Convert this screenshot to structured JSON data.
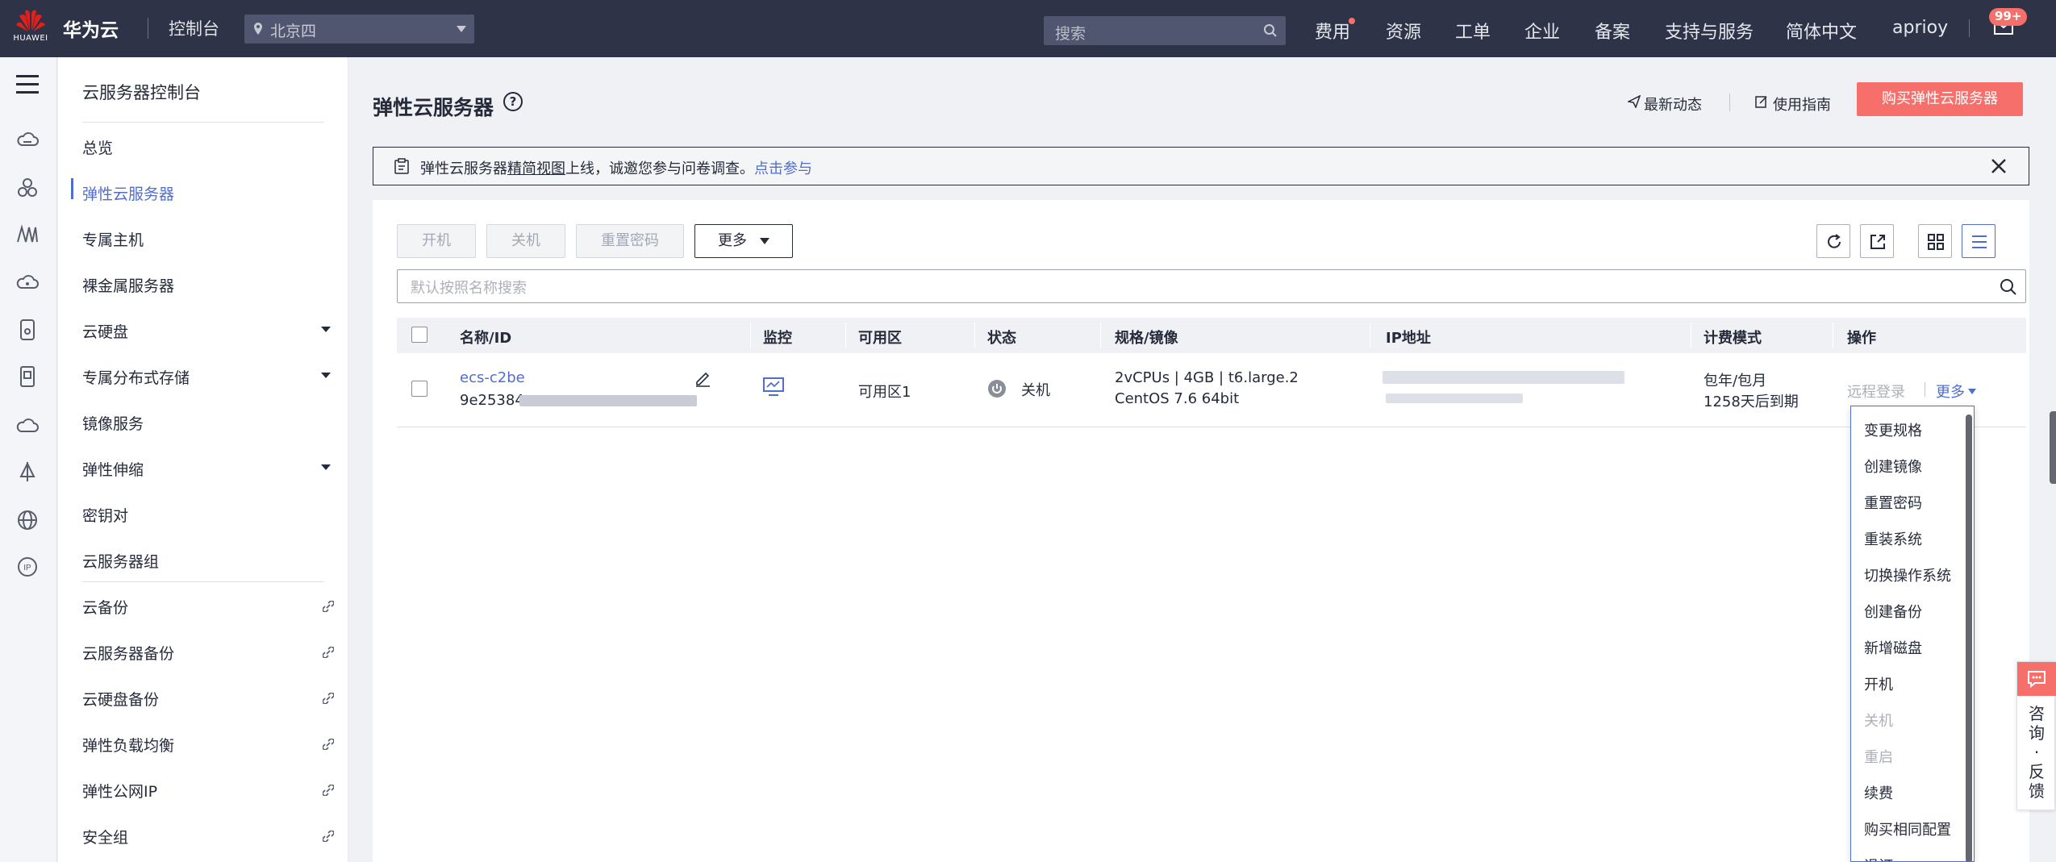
{
  "topbar": {
    "logo_sub": "HUAWEI",
    "brand": "华为云",
    "console": "控制台",
    "region": "北京四",
    "search_placeholder": "搜索",
    "nav": [
      "费用",
      "资源",
      "工单",
      "企业",
      "备案",
      "支持与服务",
      "简体中文",
      "aprioy"
    ],
    "badge": "99+"
  },
  "sidebar": {
    "title": "云服务器控制台",
    "items": [
      {
        "label": "总览"
      },
      {
        "label": "弹性云服务器"
      },
      {
        "label": "专属主机"
      },
      {
        "label": "裸金属服务器"
      },
      {
        "label": "云硬盘"
      },
      {
        "label": "专属分布式存储"
      },
      {
        "label": "镜像服务"
      },
      {
        "label": "弹性伸缩"
      },
      {
        "label": "密钥对"
      },
      {
        "label": "云服务器组"
      },
      {
        "label": "云备份"
      },
      {
        "label": "云服务器备份"
      },
      {
        "label": "云硬盘备份"
      },
      {
        "label": "弹性负载均衡"
      },
      {
        "label": "弹性公网IP"
      },
      {
        "label": "安全组"
      }
    ]
  },
  "header": {
    "title": "弹性云服务器",
    "news": "最新动态",
    "guide": "使用指南",
    "buy": "购买弹性云服务器"
  },
  "notice": {
    "pre": "弹性云服务器",
    "underlined": "精简视图",
    "post": "上线，诚邀您参与问卷调查。",
    "link": "点击参与"
  },
  "toolbar": {
    "start": "开机",
    "stop": "关机",
    "reset_password": "重置密码",
    "more": "更多",
    "search_placeholder": "默认按照名称搜索"
  },
  "table": {
    "headers": [
      "名称/ID",
      "监控",
      "可用区",
      "状态",
      "规格/镜像",
      "IP地址",
      "计费模式",
      "操作"
    ],
    "row": {
      "name": "ecs-c2be",
      "id_prefix": "9e25384",
      "zone": "可用区1",
      "status": "关机",
      "spec": "2vCPUs | 4GB | t6.large.2",
      "image": "CentOS 7.6 64bit",
      "billing": "包年/包月",
      "expiry": "1258天后到期",
      "remote_login": "远程登录",
      "more": "更多"
    }
  },
  "dropdown": {
    "items": [
      {
        "label": "变更规格",
        "disabled": false
      },
      {
        "label": "创建镜像",
        "disabled": false
      },
      {
        "label": "重置密码",
        "disabled": false
      },
      {
        "label": "重装系统",
        "disabled": false
      },
      {
        "label": "切换操作系统",
        "disabled": false
      },
      {
        "label": "创建备份",
        "disabled": false
      },
      {
        "label": "新增磁盘",
        "disabled": false
      },
      {
        "label": "开机",
        "disabled": false
      },
      {
        "label": "关机",
        "disabled": true
      },
      {
        "label": "重启",
        "disabled": true
      },
      {
        "label": "续费",
        "disabled": false
      },
      {
        "label": "购买相同配置",
        "disabled": false
      },
      {
        "label": "退订",
        "disabled": false
      }
    ]
  },
  "feedback": {
    "label": "咨询·反馈"
  },
  "colors": {
    "topbar": "#2e3348",
    "accent": "#526ecc",
    "buy": "#f66f6a"
  }
}
